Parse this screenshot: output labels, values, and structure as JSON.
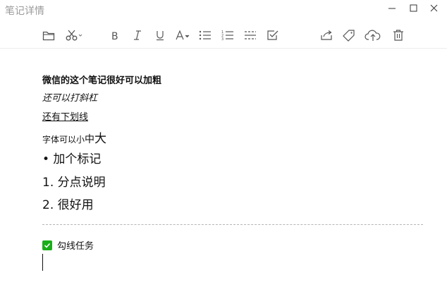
{
  "window": {
    "title": "笔记详情"
  },
  "toolbar": {
    "items": [
      {
        "icon": "folder-icon"
      },
      {
        "icon": "cut-icon"
      },
      {
        "icon": "bold-icon"
      },
      {
        "icon": "italic-icon"
      },
      {
        "icon": "underline-icon"
      },
      {
        "icon": "font-size-icon"
      },
      {
        "icon": "bullet-list-icon"
      },
      {
        "icon": "numbered-list-icon"
      },
      {
        "icon": "divider-icon"
      },
      {
        "icon": "checkbox-icon"
      },
      {
        "icon": "share-icon"
      },
      {
        "icon": "tag-icon"
      },
      {
        "icon": "cloud-upload-icon"
      },
      {
        "icon": "trash-icon"
      }
    ]
  },
  "note": {
    "bold_line": "微信的这个笔记很好可以加粗",
    "italic_line": "还可以打斜杠",
    "underline_line": "还有下划线",
    "size_small": "字体可以小",
    "size_mid": "中",
    "size_big": "大",
    "bullet_item": "• 加个标记",
    "numbered_1": "1. 分点说明",
    "numbered_2": "2. 很好用",
    "todo_label": "勾线任务"
  },
  "colors": {
    "check_green": "#1aad19",
    "title_gray": "#9a9a9a",
    "icon_gray": "#555555"
  }
}
